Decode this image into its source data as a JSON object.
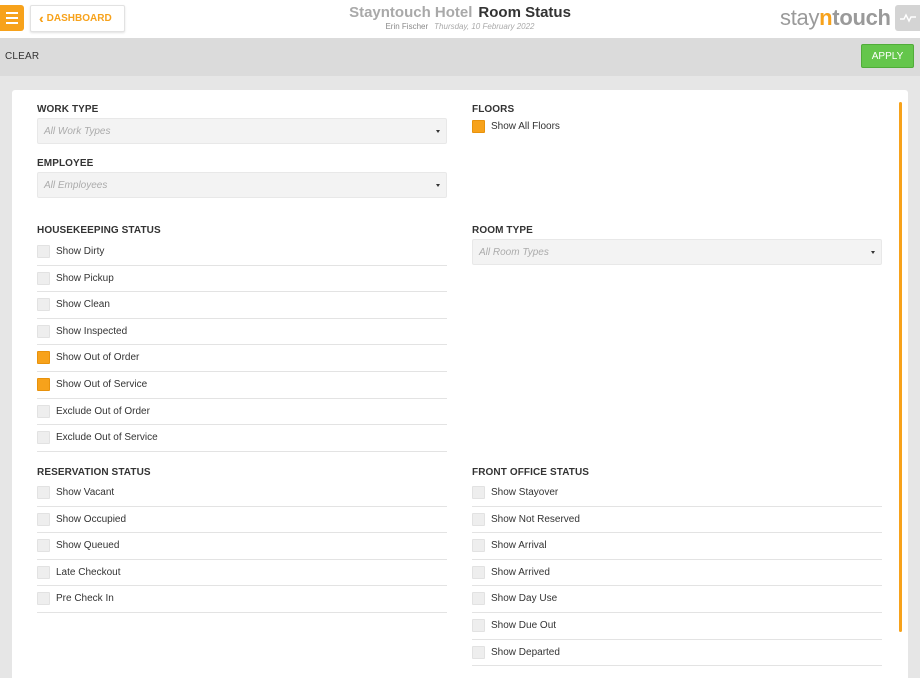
{
  "header": {
    "dashboard_label": "DASHBOARD",
    "hotel_name": "Stayntouch Hotel",
    "page_title": "Room Status",
    "user_name": "Erin Fischer",
    "date": "Thursday, 10 February 2022",
    "logo": {
      "part1": "stay",
      "part2": "n",
      "part3": "touch"
    }
  },
  "toolbar": {
    "clear_label": "CLEAR",
    "apply_label": "APPLY"
  },
  "work_type": {
    "title": "WORK TYPE",
    "placeholder": "All Work Types"
  },
  "employee": {
    "title": "EMPLOYEE",
    "placeholder": "All Employees"
  },
  "floors": {
    "title": "FLOORS",
    "items": [
      {
        "label": "Show All Floors",
        "checked": true
      }
    ]
  },
  "housekeeping": {
    "title": "HOUSEKEEPING STATUS",
    "items": [
      {
        "label": "Show Dirty",
        "checked": false
      },
      {
        "label": "Show Pickup",
        "checked": false
      },
      {
        "label": "Show Clean",
        "checked": false
      },
      {
        "label": "Show Inspected",
        "checked": false
      },
      {
        "label": "Show Out of Order",
        "checked": true
      },
      {
        "label": "Show Out of Service",
        "checked": true
      },
      {
        "label": "Exclude Out of Order",
        "checked": false
      },
      {
        "label": "Exclude Out of Service",
        "checked": false
      }
    ]
  },
  "room_type": {
    "title": "ROOM TYPE",
    "placeholder": "All Room Types"
  },
  "reservation": {
    "title": "RESERVATION STATUS",
    "items": [
      {
        "label": "Show Vacant",
        "checked": false
      },
      {
        "label": "Show Occupied",
        "checked": false
      },
      {
        "label": "Show Queued",
        "checked": false
      },
      {
        "label": "Late Checkout",
        "checked": false
      },
      {
        "label": "Pre Check In",
        "checked": false
      }
    ]
  },
  "front_office": {
    "title": "FRONT OFFICE STATUS",
    "items": [
      {
        "label": "Show Stayover",
        "checked": false
      },
      {
        "label": "Show Not Reserved",
        "checked": false
      },
      {
        "label": "Show Arrival",
        "checked": false
      },
      {
        "label": "Show Arrived",
        "checked": false
      },
      {
        "label": "Show Day Use",
        "checked": false
      },
      {
        "label": "Show Due Out",
        "checked": false
      },
      {
        "label": "Show Departed",
        "checked": false
      }
    ]
  },
  "colors": {
    "accent": "#f7a21b",
    "apply_green": "#64c64b",
    "toolbar_gray": "#dbdbdb",
    "background": "#e6e6e6"
  }
}
